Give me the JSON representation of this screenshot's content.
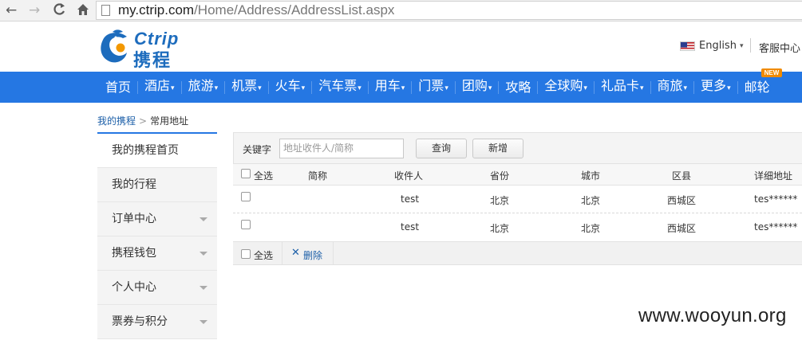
{
  "browser": {
    "back_glyph": "←",
    "forward_glyph": "→",
    "reload_glyph": "C",
    "home_glyph": "⌂",
    "url_host": "my.ctrip.com",
    "url_path": "/Home/Address/AddressList.aspx"
  },
  "header": {
    "logo_en": "Ctrip",
    "logo_cn": "携程",
    "language": "English",
    "service": "客服中心"
  },
  "nav": {
    "items": [
      {
        "label": "首页",
        "caret": false
      },
      {
        "label": "酒店",
        "caret": true
      },
      {
        "label": "旅游",
        "caret": true
      },
      {
        "label": "机票",
        "caret": true
      },
      {
        "label": "火车",
        "caret": true
      },
      {
        "label": "汽车票",
        "caret": true
      },
      {
        "label": "用车",
        "caret": true
      },
      {
        "label": "门票",
        "caret": true
      },
      {
        "label": "团购",
        "caret": true
      },
      {
        "label": "攻略",
        "caret": false
      },
      {
        "label": "全球购",
        "caret": true
      },
      {
        "label": "礼品卡",
        "caret": true
      },
      {
        "label": "商旅",
        "caret": true
      },
      {
        "label": "更多",
        "caret": true
      },
      {
        "label": "邮轮",
        "caret": false
      }
    ],
    "new_badge": "NEW",
    "caret_glyph": "▾"
  },
  "breadcrumb": {
    "home": "我的携程",
    "separator": ">",
    "current": "常用地址"
  },
  "sidebar": {
    "items": [
      {
        "label": "我的携程首页",
        "arrow": false
      },
      {
        "label": "我的行程",
        "arrow": false
      },
      {
        "label": "订单中心",
        "arrow": true
      },
      {
        "label": "携程钱包",
        "arrow": true
      },
      {
        "label": "个人中心",
        "arrow": true
      },
      {
        "label": "票券与积分",
        "arrow": true
      }
    ]
  },
  "search": {
    "label": "关键字",
    "placeholder": "地址收件人/简称",
    "query_button": "查询",
    "add_button": "新增"
  },
  "table": {
    "select_all": "全选",
    "columns": [
      "简称",
      "收件人",
      "省份",
      "城市",
      "区县",
      "详细地址"
    ],
    "rows": [
      {
        "alias": "",
        "recipient": "test",
        "province": "北京",
        "city": "北京",
        "district": "西城区",
        "address": "tes******"
      },
      {
        "alias": "",
        "recipient": "test",
        "province": "北京",
        "city": "北京",
        "district": "西城区",
        "address": "tes******"
      }
    ]
  },
  "footer": {
    "select_all": "全选",
    "delete_icon": "✕",
    "delete": "删除"
  },
  "watermark": "www.wooyun.org",
  "colors": {
    "nav_blue": "#2577e3",
    "brand_blue": "#1d6cbd",
    "link_blue": "#1c5fa8",
    "badge_orange": "#f08a00"
  }
}
